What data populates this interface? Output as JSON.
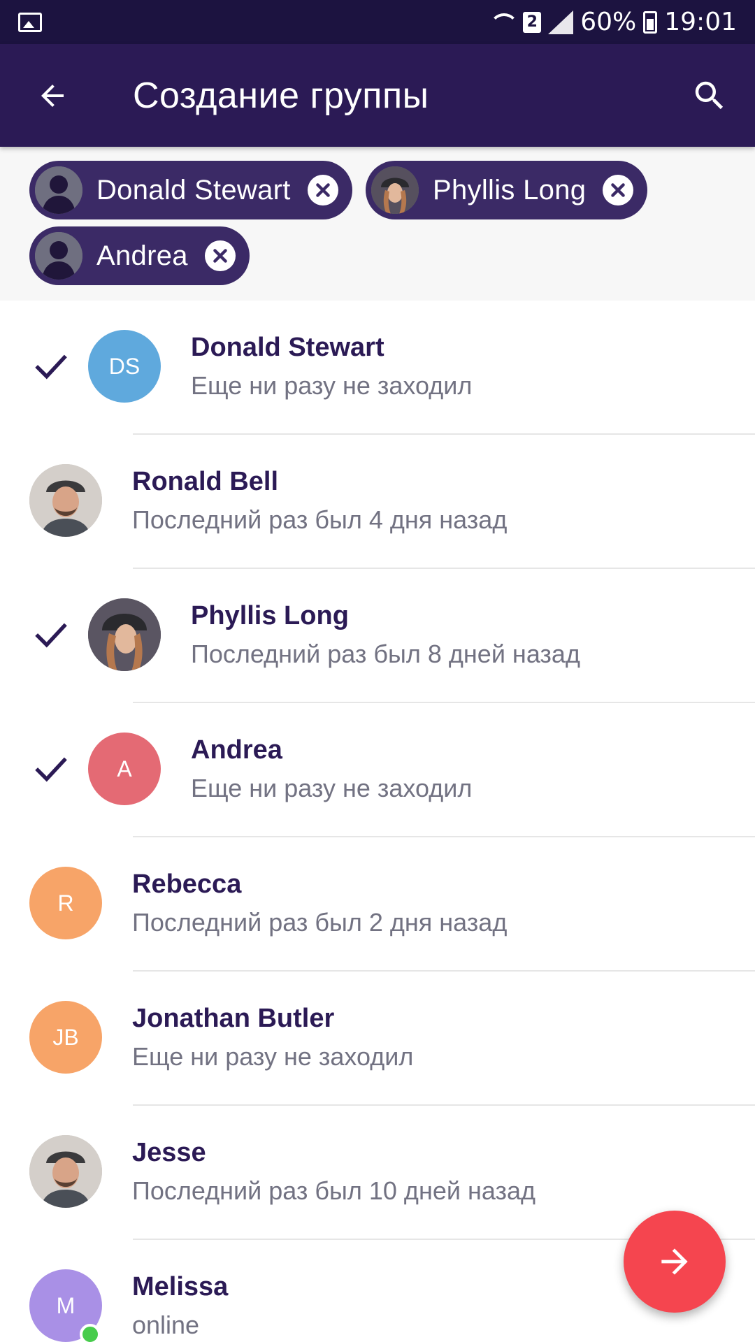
{
  "status_bar": {
    "sim_badge": "2",
    "battery": "60%",
    "time": "19:01"
  },
  "app_bar": {
    "title": "Создание группы"
  },
  "selected_chips": [
    {
      "label": "Donald Stewart",
      "avatar": "person-silhouette"
    },
    {
      "label": "Phyllis Long",
      "avatar": "photo-woman-hat"
    },
    {
      "label": "Andrea",
      "avatar": "person-silhouette"
    }
  ],
  "contacts": [
    {
      "name": "Donald Stewart",
      "status": "Еще ни разу не заходил",
      "initials": "DS",
      "color": "#5fa9dd",
      "checked": true
    },
    {
      "name": "Ronald Bell",
      "status": "Последний раз был 4 дня назад",
      "initials": "",
      "avatar": "photo-man-cap",
      "checked": false
    },
    {
      "name": "Phyllis Long",
      "status": "Последний раз был 8 дней назад",
      "initials": "",
      "avatar": "photo-woman-hat",
      "checked": true
    },
    {
      "name": "Andrea",
      "status": "Еще ни разу не заходил",
      "initials": "A",
      "color": "#e46a74",
      "checked": true
    },
    {
      "name": "Rebecca",
      "status": "Последний раз был 2 дня назад",
      "initials": "R",
      "color": "#f7a468",
      "checked": false
    },
    {
      "name": "Jonathan Butler",
      "status": "Еще ни разу не заходил",
      "initials": "JB",
      "color": "#f7a468",
      "checked": false
    },
    {
      "name": "Jesse",
      "status": "Последний раз был 10 дней назад",
      "initials": "",
      "avatar": "photo-man-cap",
      "checked": false
    },
    {
      "name": "Melissa",
      "status": "online",
      "initials": "M",
      "color": "#a990e6",
      "checked": false,
      "online": true
    }
  ],
  "colors": {
    "status_bar": "#1c1340",
    "app_bar": "#2b1a55",
    "chip": "#3b2a66",
    "fab": "#f5454f",
    "online": "#47cc4c"
  },
  "icons": {
    "back": "arrow-left-icon",
    "search": "search-icon",
    "fab": "arrow-right-icon",
    "check": "check-icon",
    "chip_close": "close-circle-icon"
  }
}
